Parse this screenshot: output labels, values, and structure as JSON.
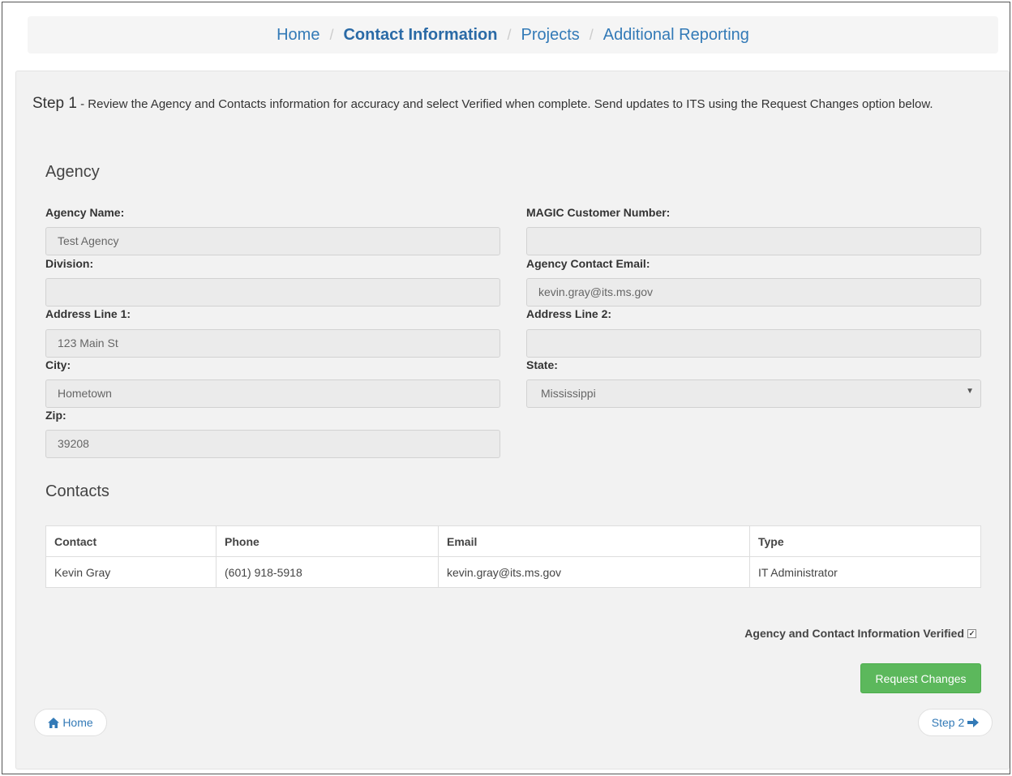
{
  "breadcrumb": {
    "items": [
      {
        "label": "Home"
      },
      {
        "label": "Contact Information"
      },
      {
        "label": "Projects"
      },
      {
        "label": "Additional Reporting"
      }
    ],
    "separator": "/"
  },
  "step": {
    "lead": "Step 1",
    "text": " - Review the Agency and Contacts information for accuracy and select Verified when complete. Send updates to ITS using the Request Changes option below."
  },
  "agency": {
    "title": "Agency",
    "agency_name_label": "Agency Name:",
    "agency_name_value": "Test Agency",
    "magic_label": "MAGIC Customer Number:",
    "magic_value": "",
    "division_label": "Division:",
    "division_value": "",
    "email_label": "Agency Contact Email:",
    "email_value": "kevin.gray@its.ms.gov",
    "address1_label": "Address Line 1:",
    "address1_value": "123 Main St",
    "address2_label": "Address Line 2:",
    "address2_value": "",
    "city_label": "City:",
    "city_value": "Hometown",
    "state_label": "State:",
    "state_value": "Mississippi",
    "zip_label": "Zip:",
    "zip_value": "39208"
  },
  "contacts": {
    "title": "Contacts",
    "headers": [
      "Contact",
      "Phone",
      "Email",
      "Type"
    ],
    "rows": [
      [
        "Kevin Gray",
        "(601) 918-5918",
        "kevin.gray@its.ms.gov",
        "IT Administrator"
      ]
    ]
  },
  "verified_label": "Agency and Contact Information Verified",
  "verified_checked": true,
  "request_changes_label": "Request Changes",
  "home_button_label": "Home",
  "step2_button_label": "Step 2",
  "colors": {
    "link": "#337ab7",
    "success": "#5cb85c"
  }
}
